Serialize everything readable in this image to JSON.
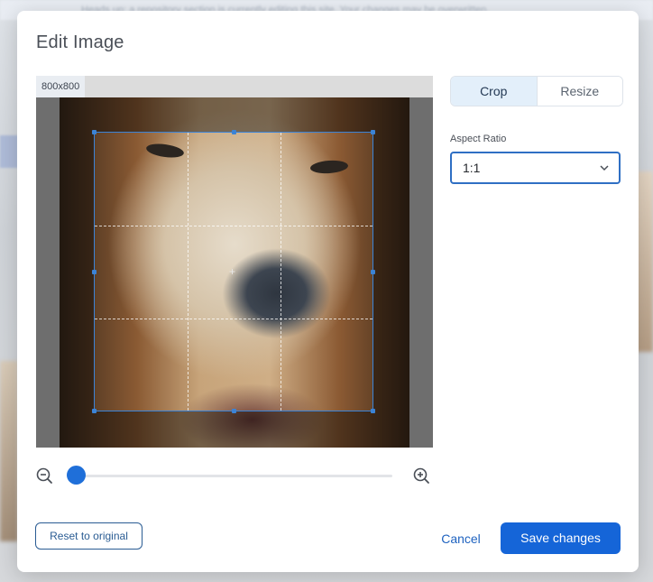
{
  "background": {
    "banner_text": "Heads up: a repository section is currently editing this site. Your changes may be overwritten."
  },
  "modal": {
    "title": "Edit Image",
    "image": {
      "dimensions_badge": "800x800",
      "alt_subject": "close-up of a dog's face"
    },
    "zoom": {
      "level_fraction": 0.0
    },
    "tabs": [
      {
        "label": "Crop",
        "active": true
      },
      {
        "label": "Resize",
        "active": false
      }
    ],
    "aspect_ratio": {
      "label": "Aspect Ratio",
      "value": "1:1"
    },
    "buttons": {
      "reset": "Reset to original",
      "cancel": "Cancel",
      "save": "Save changes"
    },
    "colors": {
      "primary": "#1565d8",
      "crop_border": "#3b83d6",
      "active_tab_bg": "#e3effa"
    }
  }
}
